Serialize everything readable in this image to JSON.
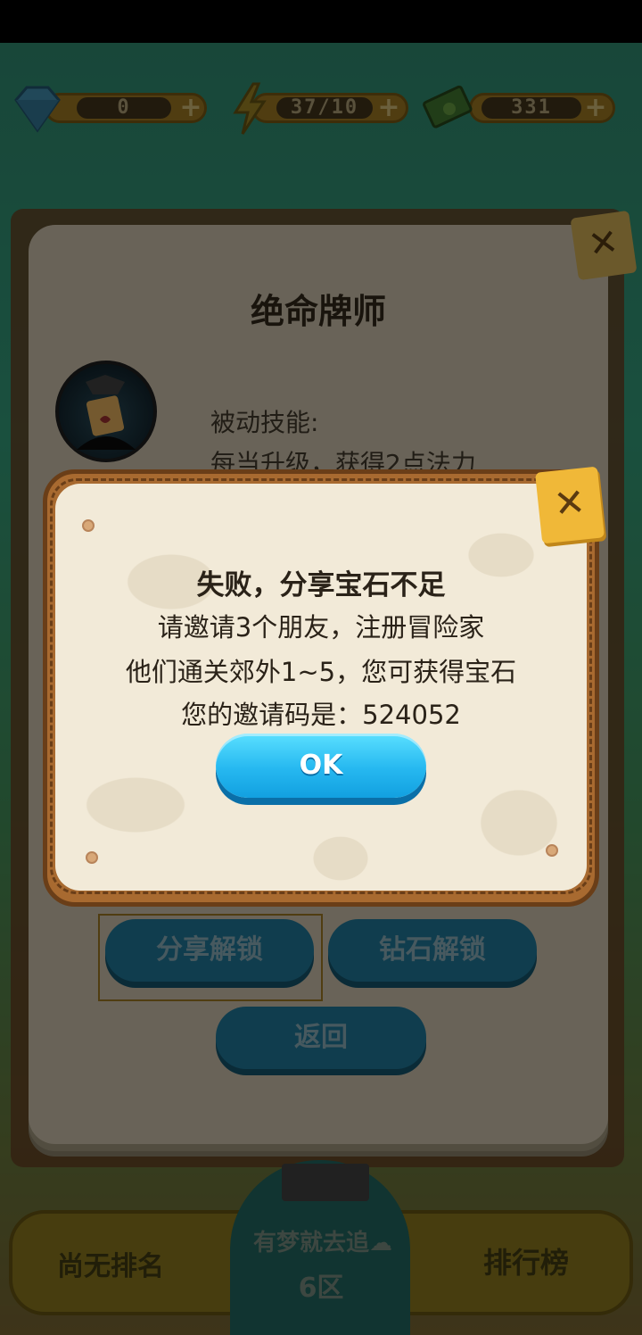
{
  "hud": {
    "diamonds": "0",
    "energy": "37/10",
    "cash": "331"
  },
  "hero_panel": {
    "title": "绝命牌师",
    "skill_label": "被动技能:",
    "skill_desc": "每当升级，获得2点法力",
    "share_unlock": "分享解锁",
    "diamond_unlock": "钻石解锁",
    "back": "返回"
  },
  "bottom_bar": {
    "rank": "尚无排名",
    "motto": "有梦就去追☁",
    "zone": "6区",
    "leaderboard": "排行榜"
  },
  "dialog": {
    "title": "失败，分享宝石不足",
    "line1": "请邀请3个朋友，注册冒险家",
    "line2": "他们通关郊外1~5，您可获得宝石",
    "line3": "您的邀请码是：524052",
    "ok": "OK"
  },
  "colors": {
    "ok_button": "#26b8f0",
    "dialog_bg": "#f2ead8",
    "frame": "#a86a30"
  }
}
